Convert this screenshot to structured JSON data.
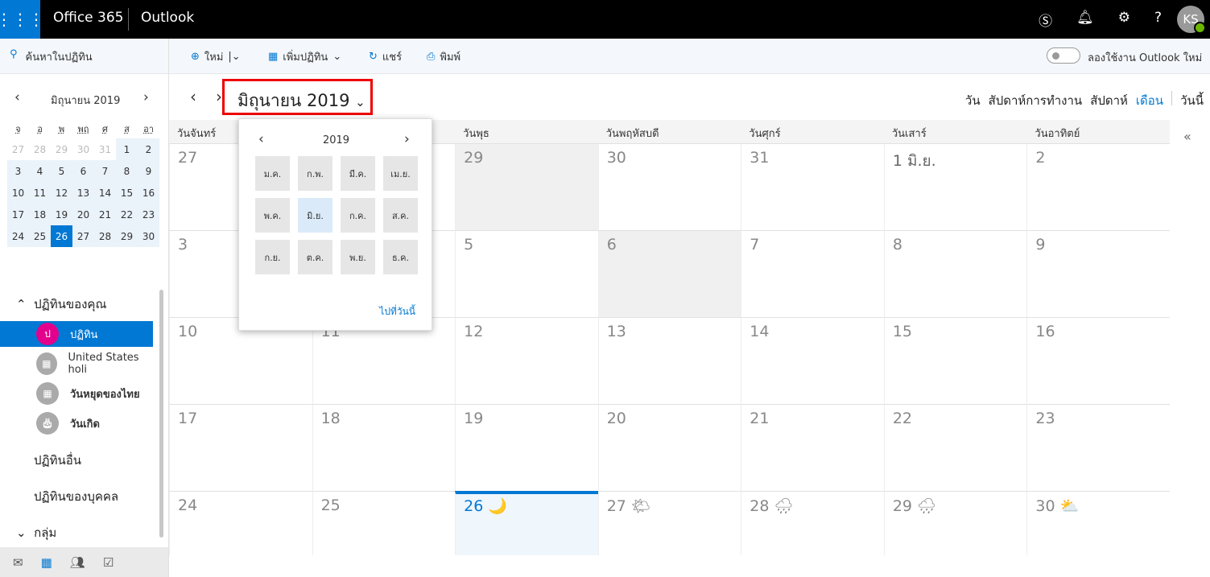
{
  "topbar": {
    "brand": "Office 365",
    "app": "Outlook",
    "avatar": "KS",
    "icons": [
      "waffle-icon",
      "skype-icon",
      "bell-icon",
      "gear-icon",
      "help-icon"
    ]
  },
  "toolbar": {
    "search": "ค้นหาในปฏิทิน",
    "new": "ใหม่",
    "add_calendar": "เพิ่มปฏิทิน",
    "share": "แชร์",
    "print": "พิมพ์",
    "try_new": "ลองใช้งาน Outlook ใหม่",
    "try_new_on": false
  },
  "mini": {
    "title": "มิถุนายน 2019",
    "weekdays": [
      "จ",
      "อ",
      "พ",
      "พฤ",
      "ศ",
      "ส",
      "อา"
    ],
    "weeks": [
      [
        "27",
        "28",
        "29",
        "30",
        "31",
        "1",
        "2"
      ],
      [
        "3",
        "4",
        "5",
        "6",
        "7",
        "8",
        "9"
      ],
      [
        "10",
        "11",
        "12",
        "13",
        "14",
        "15",
        "16"
      ],
      [
        "17",
        "18",
        "19",
        "20",
        "21",
        "22",
        "23"
      ],
      [
        "24",
        "25",
        "26",
        "27",
        "28",
        "29",
        "30"
      ]
    ],
    "today": "26"
  },
  "sidebar": {
    "your_calendars": "ปฏิทินของคุณ",
    "calendars": [
      {
        "label": "ปฏิทิน",
        "badge": "ป",
        "color": "#e3008c",
        "selected": true
      },
      {
        "label": "United States holi",
        "icon": "calendar-icon"
      },
      {
        "label": "วันหยุดของไทย",
        "icon": "calendar-icon"
      },
      {
        "label": "วันเกิด",
        "icon": "cake-icon"
      }
    ],
    "other": "ปฏิทินอื่น",
    "people": "ปฏิทินของบุคคล",
    "groups": "กลุ่ม"
  },
  "main": {
    "title": "มิถุนายน 2019",
    "views": [
      "วัน",
      "สัปดาห์การทำงาน",
      "สัปดาห์",
      "เดือน"
    ],
    "active_view": "เดือน",
    "today": "วันนี้",
    "weekdays": [
      "วันจันทร์",
      "วันอังคาร",
      "วันพุธ",
      "วันพฤหัสบดี",
      "วันศุกร์",
      "วันเสาร์",
      "วันอาทิตย์"
    ],
    "weeks": [
      [
        "27",
        "28",
        "29",
        "30",
        "31",
        "1 มิ.ย.",
        "2"
      ],
      [
        "3",
        "4",
        "5",
        "6",
        "7",
        "8",
        "9"
      ],
      [
        "10",
        "11",
        "12",
        "13",
        "14",
        "15",
        "16"
      ],
      [
        "17",
        "18",
        "19",
        "20",
        "21",
        "22",
        "23"
      ],
      [
        "24",
        "25",
        "26 🌙",
        "27 🌤",
        "28 🌧",
        "29 🌧",
        "30 ⛅"
      ]
    ]
  },
  "picker": {
    "year": "2019",
    "months": [
      "ม.ค.",
      "ก.พ.",
      "มี.ค.",
      "เม.ย.",
      "พ.ค.",
      "มิ.ย.",
      "ก.ค.",
      "ส.ค.",
      "ก.ย.",
      "ต.ค.",
      "พ.ย.",
      "ธ.ค."
    ],
    "selected": "มิ.ย.",
    "goto_today": "ไปที่วันนี้"
  },
  "colors": {
    "accent": "#0078d4",
    "highlight": "#e00000"
  }
}
